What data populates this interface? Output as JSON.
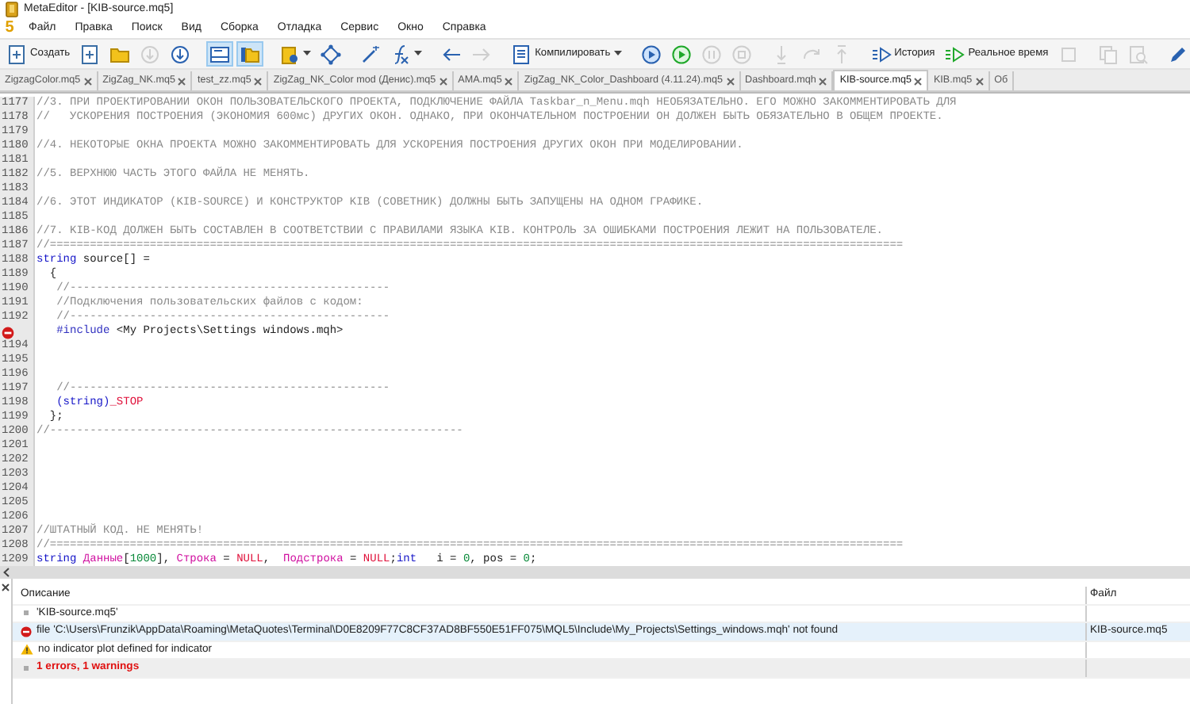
{
  "window": {
    "title": "MetaEditor - [KIB-source.mq5]"
  },
  "menu": {
    "logo": "5",
    "items": [
      "Файл",
      "Правка",
      "Поиск",
      "Вид",
      "Сборка",
      "Отладка",
      "Сервис",
      "Окно",
      "Справка"
    ]
  },
  "toolbar": [
    {
      "kind": "button",
      "label": "Создать",
      "disabled": false,
      "pressed": false
    },
    {
      "kind": "icon",
      "disabled": false,
      "pressed": false
    },
    {
      "kind": "icon",
      "disabled": false,
      "pressed": false
    },
    {
      "kind": "icon",
      "disabled": true,
      "pressed": false
    },
    {
      "kind": "icon",
      "disabled": false,
      "pressed": false
    },
    {
      "kind": "separator"
    },
    {
      "kind": "icon",
      "disabled": false,
      "pressed": true
    },
    {
      "kind": "icon",
      "disabled": false,
      "pressed": true
    },
    {
      "kind": "separator"
    },
    {
      "kind": "dropdown",
      "disabled": false,
      "pressed": false
    },
    {
      "kind": "icon",
      "disabled": false,
      "pressed": false
    },
    {
      "kind": "separator"
    },
    {
      "kind": "icon",
      "disabled": false,
      "pressed": false
    },
    {
      "kind": "dropdown",
      "disabled": false,
      "pressed": false
    },
    {
      "kind": "separator"
    },
    {
      "kind": "icon",
      "disabled": false,
      "pressed": false
    },
    {
      "kind": "icon",
      "disabled": true,
      "pressed": false
    },
    {
      "kind": "separator"
    },
    {
      "kind": "button",
      "label": "Компилировать",
      "dropdown": true,
      "disabled": false,
      "pressed": false
    },
    {
      "kind": "separator"
    },
    {
      "kind": "icon",
      "disabled": false,
      "pressed": false
    },
    {
      "kind": "icon",
      "disabled": false,
      "pressed": false
    },
    {
      "kind": "icon",
      "disabled": true,
      "pressed": false
    },
    {
      "kind": "icon",
      "disabled": true,
      "pressed": false
    },
    {
      "kind": "separator"
    },
    {
      "kind": "icon",
      "disabled": true,
      "pressed": false
    },
    {
      "kind": "icon",
      "disabled": true,
      "pressed": false
    },
    {
      "kind": "icon",
      "disabled": true,
      "pressed": false
    },
    {
      "kind": "separator"
    },
    {
      "kind": "button",
      "label": "История",
      "disabled": false,
      "pressed": false
    },
    {
      "kind": "button",
      "label": "Реальное время",
      "disabled": false,
      "pressed": false
    },
    {
      "kind": "icon",
      "disabled": true,
      "pressed": false
    },
    {
      "kind": "separator"
    },
    {
      "kind": "icon",
      "disabled": true,
      "pressed": false
    },
    {
      "kind": "icon",
      "disabled": true,
      "pressed": false
    },
    {
      "kind": "separator"
    },
    {
      "kind": "icon",
      "disabled": false,
      "pressed": false
    }
  ],
  "tabs": [
    {
      "label": "ZigzagColor.mq5",
      "selected": false,
      "closable": true
    },
    {
      "label": "ZigZag_NK.mq5",
      "selected": false,
      "closable": true
    },
    {
      "label": "test_zz.mq5",
      "selected": false,
      "closable": true
    },
    {
      "label": "ZigZag_NK_Color mod (Денис).mq5",
      "selected": false,
      "closable": true
    },
    {
      "label": "AMA.mq5",
      "selected": false,
      "closable": true
    },
    {
      "label": "ZigZag_NK_Color_Dashboard (4.11.24).mq5",
      "selected": false,
      "closable": true
    },
    {
      "label": "Dashboard.mqh",
      "selected": false,
      "closable": true
    },
    {
      "label": "KIB-source.mq5",
      "selected": true,
      "closable": true
    },
    {
      "label": "KIB.mq5",
      "selected": false,
      "closable": true
    },
    {
      "label": "Об",
      "selected": false,
      "closable": false
    }
  ],
  "editor": {
    "lines": [
      {
        "kind": "code",
        "num": "1177",
        "tokens": [
          {
            "kind": "comment",
            "text": "//3. ПРИ ПРОЕКТИРОВАНИИ ОКОН ПОЛЬЗОВАТЕЛЬСКОГО ПРОЕКТА, ПОДКЛЮЧЕНИЕ ФАЙЛА Taskbar_n_Menu.mqh НЕОБЯЗАТЕЛЬНО. ЕГО МОЖНО ЗАКОММЕНТИРОВАТЬ ДЛЯ"
          }
        ]
      },
      {
        "kind": "code",
        "num": "1178",
        "tokens": [
          {
            "kind": "comment",
            "text": "//   УСКОРЕНИЯ ПОСТРОЕНИЯ (ЭКОНОМИЯ 600мс) ДРУГИХ ОКОН. ОДНАКО, ПРИ ОКОНЧАТЕЛЬНОМ ПОСТРОЕНИИ ОН ДОЛЖЕН БЫТЬ ОБЯЗАТЕЛЬНО В ОБЩЕМ ПРОЕКТЕ."
          }
        ]
      },
      {
        "kind": "code",
        "num": "1179"
      },
      {
        "kind": "code",
        "num": "1180",
        "tokens": [
          {
            "kind": "comment",
            "text": "//4. НЕКОТОРЫЕ ОКНА ПРОЕКТА МОЖНО ЗАКОММЕНТИРОВАТЬ ДЛЯ УСКОРЕНИЯ ПОСТРОЕНИЯ ДРУГИХ ОКОН ПРИ МОДЕЛИРОВАНИИ."
          }
        ]
      },
      {
        "kind": "code",
        "num": "1181"
      },
      {
        "kind": "code",
        "num": "1182",
        "tokens": [
          {
            "kind": "comment",
            "text": "//5. ВЕРХНЮЮ ЧАСТЬ ЭТОГО ФАЙЛА НЕ МЕНЯТЬ."
          }
        ]
      },
      {
        "kind": "code",
        "num": "1183"
      },
      {
        "kind": "code",
        "num": "1184",
        "tokens": [
          {
            "kind": "comment",
            "text": "//6. ЭТОТ ИНДИКАТОР (KIB-SOURCE) И КОНСТРУКТОР KIB (СОВЕТНИК) ДОЛЖНЫ БЫТЬ ЗАПУЩЕНЫ НА ОДНОМ ГРАФИКЕ."
          }
        ]
      },
      {
        "kind": "code",
        "num": "1185"
      },
      {
        "kind": "code",
        "num": "1186",
        "tokens": [
          {
            "kind": "comment",
            "text": "//7. KIB-КОД ДОЛЖЕН БЫТЬ СОСТАВЛЕН В СООТВЕТСТВИИ С ПРАВИЛАМИ ЯЗЫКА KIB. КОНТРОЛЬ ЗА ОШИБКАМИ ПОСТРОЕНИЯ ЛЕЖИТ НА ПОЛЬЗОВАТЕЛЕ."
          }
        ]
      },
      {
        "kind": "code",
        "num": "1187",
        "tokens": [
          {
            "kind": "comment",
            "text": "//================================================================================================================================"
          }
        ]
      },
      {
        "kind": "code",
        "num": "1188",
        "tokens": [
          {
            "kind": "keyword",
            "text": "string"
          },
          {
            "kind": "plain",
            "text": " source[] ="
          }
        ]
      },
      {
        "kind": "code",
        "num": "1189",
        "tokens": [
          {
            "kind": "plain",
            "text": "  {"
          }
        ]
      },
      {
        "kind": "code",
        "num": "1190",
        "tokens": [
          {
            "kind": "comment",
            "text": "   //------------------------------------------------"
          }
        ]
      },
      {
        "kind": "code",
        "num": "1191",
        "tokens": [
          {
            "kind": "comment",
            "text": "   //Подключения пользовательских файлов с кодом:"
          }
        ]
      },
      {
        "kind": "code",
        "num": "1192",
        "tokens": [
          {
            "kind": "comment",
            "text": "   //------------------------------------------------"
          }
        ]
      },
      {
        "kind": "error",
        "tokens": [
          {
            "kind": "macro",
            "text": "   #include"
          },
          {
            "kind": "plain",
            "text": " <My Projects\\Settings windows.mqh>"
          }
        ]
      },
      {
        "kind": "code",
        "num": "1194"
      },
      {
        "kind": "code",
        "num": "1195"
      },
      {
        "kind": "code",
        "num": "1196"
      },
      {
        "kind": "code",
        "num": "1197",
        "tokens": [
          {
            "kind": "comment",
            "text": "   //------------------------------------------------"
          }
        ]
      },
      {
        "kind": "code",
        "num": "1198",
        "tokens": [
          {
            "kind": "keyword",
            "text": "   (string)"
          },
          {
            "kind": "constant",
            "text": "_STOP"
          }
        ]
      },
      {
        "kind": "code",
        "num": "1199",
        "tokens": [
          {
            "kind": "plain",
            "text": "  };"
          }
        ]
      },
      {
        "kind": "code",
        "num": "1200",
        "tokens": [
          {
            "kind": "comment",
            "text": "//--------------------------------------------------------------"
          }
        ]
      },
      {
        "kind": "code",
        "num": "1201"
      },
      {
        "kind": "code",
        "num": "1202"
      },
      {
        "kind": "code",
        "num": "1203"
      },
      {
        "kind": "code",
        "num": "1204"
      },
      {
        "kind": "code",
        "num": "1205"
      },
      {
        "kind": "code",
        "num": "1206"
      },
      {
        "kind": "code",
        "num": "1207",
        "tokens": [
          {
            "kind": "comment",
            "text": "//ШТАТНЫЙ КОД. НЕ МЕНЯТЬ!"
          }
        ]
      },
      {
        "kind": "code",
        "num": "1208",
        "tokens": [
          {
            "kind": "comment",
            "text": "//================================================================================================================================"
          }
        ]
      },
      {
        "kind": "code",
        "num": "1209",
        "tokens": [
          {
            "kind": "keyword",
            "text": "string"
          },
          {
            "kind": "variable",
            "text": " Данные"
          },
          {
            "kind": "plain",
            "text": "["
          },
          {
            "kind": "number",
            "text": "1000"
          },
          {
            "kind": "plain",
            "text": "], "
          },
          {
            "kind": "variable",
            "text": "Строка"
          },
          {
            "kind": "plain",
            "text": " = "
          },
          {
            "kind": "constant",
            "text": "NULL"
          },
          {
            "kind": "plain",
            "text": ",  "
          },
          {
            "kind": "variable",
            "text": "Подстрока"
          },
          {
            "kind": "plain",
            "text": " = "
          },
          {
            "kind": "constant",
            "text": "NULL"
          },
          {
            "kind": "plain",
            "text": ";"
          },
          {
            "kind": "keyword",
            "text": "int"
          },
          {
            "kind": "plain",
            "text": "   i = "
          },
          {
            "kind": "number",
            "text": "0"
          },
          {
            "kind": "plain",
            "text": ", pos = "
          },
          {
            "kind": "number",
            "text": "0"
          },
          {
            "kind": "plain",
            "text": ";"
          }
        ]
      }
    ]
  },
  "errors": {
    "columns": [
      "Описание",
      "Файл"
    ],
    "rows": [
      {
        "kind": "file",
        "text": "'KIB-source.mq5'",
        "selected": false
      },
      {
        "kind": "error",
        "text": "file 'C:\\Users\\Frunzik\\AppData\\Roaming\\MetaQuotes\\Terminal\\D0E8209F77C8CF37AD8BF550E51FF075\\MQL5\\Include\\My_Projects\\Settings_windows.mqh' not found",
        "file": "KIB-source.mq5",
        "selected": true
      },
      {
        "kind": "warning",
        "text": "no indicator plot defined for indicator",
        "selected": false
      },
      {
        "kind": "summary",
        "text": "1 errors, 1 warnings",
        "selected": false
      }
    ]
  }
}
